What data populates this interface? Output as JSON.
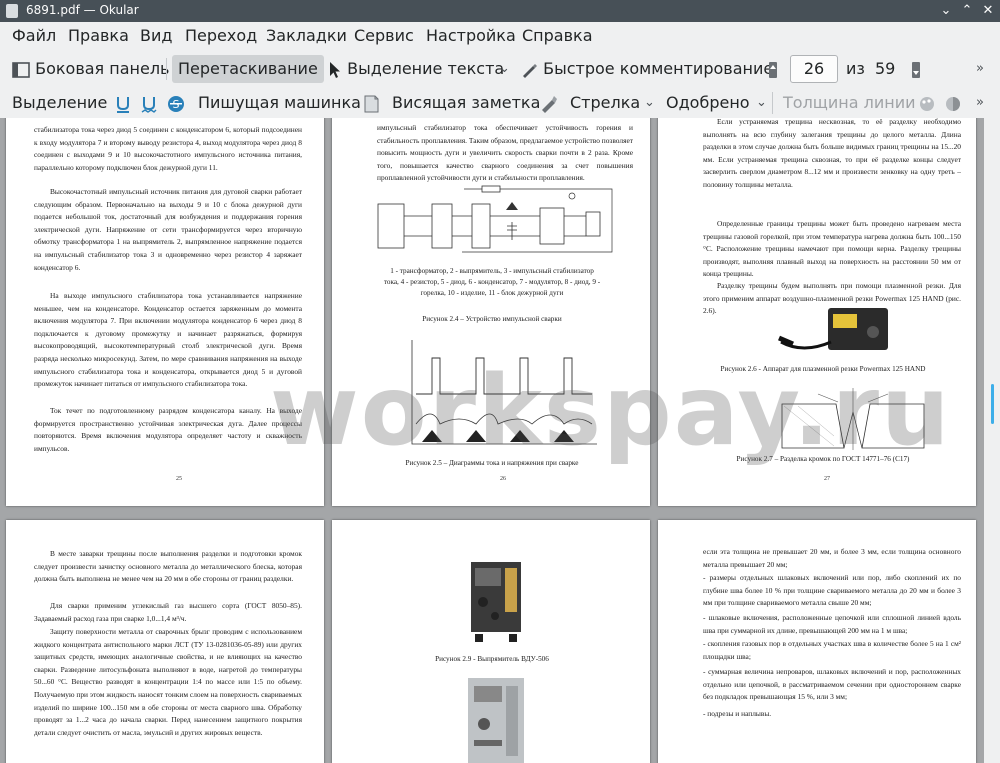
{
  "window": {
    "title": "6891.pdf — Okular"
  },
  "menu": [
    "Файл",
    "Правка",
    "Вид",
    "Переход",
    "Закладки",
    "Сервис",
    "Настройка",
    "Справка"
  ],
  "toolbar": {
    "sidebar": "Боковая панель",
    "drag": "Перетаскивание",
    "text_select": "Выделение текста",
    "quick_comment": "Быстрое комментирование",
    "page_current": "26",
    "page_of": "из",
    "page_total": "59"
  },
  "annot_toolbar": {
    "highlight": "Выделение",
    "typewriter": "Пишущая машинка",
    "sticky_note": "Висящая заметка",
    "arrow": "Стрелка",
    "approved": "Одобрено",
    "line_width": "Толщина линии"
  },
  "watermark": "workspay.ru",
  "pages": {
    "p25": {
      "number": "25",
      "paragraphs": [
        "стабилизатора тока через диод 5 соединен с конденсатором 6, который подсоединен к входу модулятора 7 и второму выводу резистора 4, выход модулятора через диод 8 соединен с выходами 9 и 10 высокочастотного импульсного источника питания, параллельно которому подключен блок дежурной дуги 11.",
        "Высокочастотный импульсный источник питания для дуговой сварки работает следующим образом. Первоначально на выходы 9 и 10 с блока дежурной дуги подается небольшой ток, достаточный для возбуждения и поддержания горения электрической дуги. Напряжение от сети трансформируется через вторичную обмотку трансформатора 1 на выпрямитель 2, выпрямленное напряжение подается на импульсный стабилизатор тока 3 и одновременно через резистор 4 заряжает конденсатор 6.",
        "На выходе импульсного стабилизатора тока устанавливается напряжение меньшее, чем на конденсаторе. Конденсатор остается заряженным до момента включения модулятора 7. При включении модулятора конденсатор 6 через диод 8 подключается к дуговому промежутку и начинает разряжаться, формируя высокопроводящий, высокотемпературный столб электрической дуги. Время разряда несколько микросекунд. Затем, по мере сравнивания напряжения на выходе импульсного стабилизатора тока и конденсатора, открывается диод 5 и дуговой промежуток начинает питаться от импульсного стабилизатора тока.",
        "Ток течет по подготовленному разрядом конденсатора каналу. На выходе формируется пространственно устойчивая электрическая дуга. Далее процессы повторяются. Время включения модулятора определяет частоту и скважность импульсов."
      ]
    },
    "p26": {
      "number": "26",
      "intro": "импульсный стабилизатор тока обеспечивает устойчивость горения и стабильность проплавления. Таким образом, предлагаемое устройство позволяет повысить мощность дуги и увеличить скорость сварки почти в 2 раза. Кроме того, повышается качество сварного соединения за счет повышения проплавленной устойчивости дуги и стабильности проплавления.",
      "legend": "1 - трансформатор, 2 - выпрямитель, 3 - импульсный стабилизатор тока, 4 - резистор, 5 - диод, 6 - конденсатор, 7 - модулятор, 8 - диод, 9 - горелка, 10 - изделие, 11 - блок дежурной дуги",
      "fig24": "Рисунок 2.4 – Устройство импульсной сварки",
      "fig25": "Рисунок 2.5 – Диаграммы тока и напряжения при сварке"
    },
    "p27": {
      "number": "27",
      "para1": "Если устраняемая трещина несквозная, то её разделку необходимо выполнять на всю глубину залегания трещины до целого металла. Длина разделки в этом случае должна быть больше видимых границ трещины на 15...20 мм. Если устраняемая трещина сквозная, то при её разделке концы следует засверлить сверлом диаметром 8...12 мм и произвести зенковку на одну треть – половину толщины металла.",
      "para2": "Определенные границы трещины может быть проведено нагреваем места трещины газовой горелкой, при этом температура нагрева должна быть 100...150 °С. Расположение трещины намечают при помощи керна. Разделку трещины производят, выполняя плавный выход на поверхность на расстоянии 50 мм от конца трещины.",
      "para3": "Разделку трещины будем выполнять при помощи плазменной резки. Для этого применим аппарат воздушно-плазменной резки Powermax 125 HAND (рис. 2.6).",
      "fig26": "Рисунок 2.6 - Аппарат для плазменной резки Powermax 125 HAND",
      "fig27": "Рисунок 2.7 – Разделка кромок по ГОСТ 14771–76 (С17)"
    },
    "p28": {
      "para1": "В месте заварки трещины после выполнения разделки и подготовки кромок следует произвести зачистку основного металла до металлического блеска, которая должна быть выполнена не менее чем на 20 мм в обе стороны от границ разделки.",
      "para2": "Для сварки применим углекислый газ высшего сорта (ГОСТ 8050–85). Задаваемый расход газа при сварке 1,0...1,4 м³/ч.",
      "para3": "Защиту поверхности металла от сварочных брызг проводим с использованием жидкого концентрата антиспольного марки ЛСТ (ТУ 13-0281036-05-89) или других защитных средств, имеющих аналогичные свойства, и не влияющих на качество сварки. Разведение литосульфоната выполняют в воде, нагретой до температуры 50...60 °С. Вещество разводят в концентрации 1:4 по массе или 1:5 по объему. Получаемую при этом жидкость наносят тонким слоем на поверхность свариваемых изделий по ширине 100...150 мм в обе стороны от места сварного шва. Обработку проводят за 1...2 часа до начала сварки. Перед нанесением защитного покрытия детали следует очистить от масла, эмульсий и других жировых веществ."
    },
    "p29": {
      "fig29": "Рисунок 2.9 - Выпрямитель ВДУ-506"
    },
    "p30": {
      "items": [
        "если эта толщина не превышает 20 мм, и более 3 мм, если толщина основного металла превышает 20 мм;",
        "- размеры отдельных шлаковых включений или пор, либо скоплений их по глубине шва более 10 % при толщине свариваемого металла до 20 мм и более 3 мм при толщине свариваемого металла свыше 20 мм;",
        "- шлаковые включения, расположенные цепочкой или сплошной линией вдоль шва при суммарной их длине, превышающей 200 мм на 1 м шва;",
        "- скопления газовых пор в отдельных участках шва в количестве более 5 на 1 см² площадки шва;",
        "- суммарная величина непроваров, шлаковых включений и пор, расположенных отдельно или цепочкой, в рассматриваемом сечении при одностороннем сварке без подкладок превышающая 15 %, или 3 мм;",
        "- подрезы и наплывы."
      ]
    }
  }
}
